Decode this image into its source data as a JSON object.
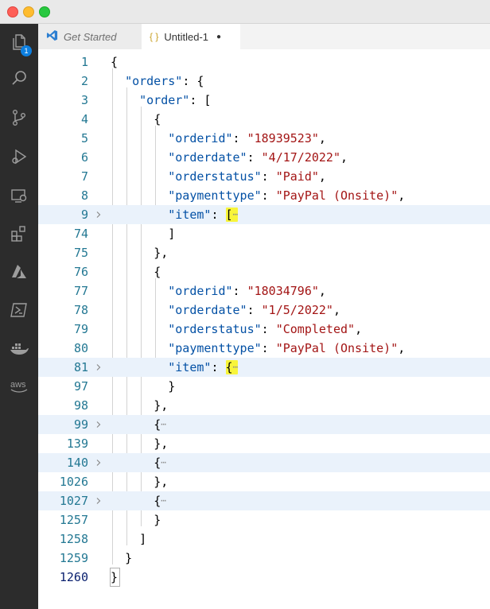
{
  "tabs": [
    {
      "label": "Get Started",
      "icon": "vscode-logo-icon",
      "active": false
    },
    {
      "label": "Untitled-1",
      "icon": "json-braces-icon",
      "active": true,
      "dirty_marker": "●"
    }
  ],
  "tab_icons": {
    "json": "{ }"
  },
  "activity_bar": {
    "items": [
      "explorer-icon",
      "search-icon",
      "source-control-icon",
      "run-debug-icon",
      "remote-explorer-icon",
      "extensions-icon",
      "azure-icon",
      "powershell-icon",
      "docker-icon",
      "aws-icon"
    ],
    "explorer_badge": "1"
  },
  "colors": {
    "key": "#0451a5",
    "string": "#a31515",
    "line_number": "#237893",
    "highlight": "#f8f53a",
    "folded_bg": "#eaf2fb"
  },
  "lines": [
    {
      "n": "1",
      "code": "{"
    },
    {
      "n": "2",
      "code": "  \"orders\": {"
    },
    {
      "n": "3",
      "code": "    \"order\": ["
    },
    {
      "n": "4",
      "code": "      {"
    },
    {
      "n": "5",
      "code": "        \"orderid\": \"18939523\","
    },
    {
      "n": "6",
      "code": "        \"orderdate\": \"4/17/2022\","
    },
    {
      "n": "7",
      "code": "        \"orderstatus\": \"Paid\","
    },
    {
      "n": "8",
      "code": "        \"paymenttype\": \"PayPal (Onsite)\","
    },
    {
      "n": "9",
      "code": "        \"item\": […",
      "folded": true
    },
    {
      "n": "74",
      "code": "        ]"
    },
    {
      "n": "75",
      "code": "      },"
    },
    {
      "n": "76",
      "code": "      {"
    },
    {
      "n": "77",
      "code": "        \"orderid\": \"18034796\","
    },
    {
      "n": "78",
      "code": "        \"orderdate\": \"1/5/2022\","
    },
    {
      "n": "79",
      "code": "        \"orderstatus\": \"Completed\","
    },
    {
      "n": "80",
      "code": "        \"paymenttype\": \"PayPal (Onsite)\","
    },
    {
      "n": "81",
      "code": "        \"item\": {…",
      "folded": true
    },
    {
      "n": "97",
      "code": "        }"
    },
    {
      "n": "98",
      "code": "      },"
    },
    {
      "n": "99",
      "code": "      {…",
      "folded": true
    },
    {
      "n": "139",
      "code": "      },"
    },
    {
      "n": "140",
      "code": "      {…",
      "folded": true
    },
    {
      "n": "1026",
      "code": "      },"
    },
    {
      "n": "1027",
      "code": "      {…",
      "folded": true
    },
    {
      "n": "1257",
      "code": "      }"
    },
    {
      "n": "1258",
      "code": "    ]"
    },
    {
      "n": "1259",
      "code": "  }"
    },
    {
      "n": "1260",
      "code": "}",
      "current": true
    }
  ]
}
